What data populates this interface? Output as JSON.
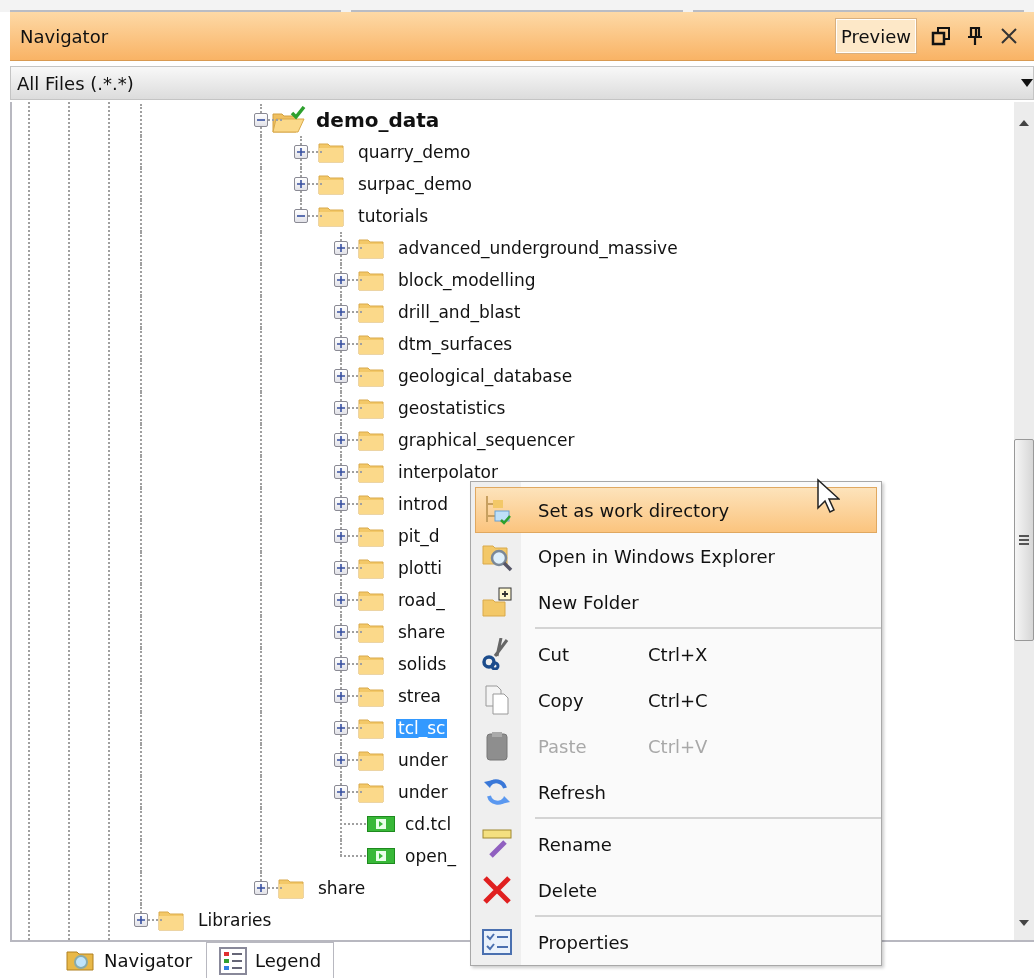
{
  "panel": {
    "title": "Navigator",
    "preview_button": "Preview"
  },
  "filter": {
    "value": "All Files (.*.*)"
  },
  "tree": [
    {
      "children": [
        {
          "children": [
            {
              "children": [
                {
                  "label": "demo_data",
                  "kind": "folder",
                  "expanded": true,
                  "selected": false,
                  "work_directory": true,
                  "children": [
                    {
                      "label": "quarry_demo",
                      "kind": "folder",
                      "expanded": false,
                      "selected": false,
                      "work_directory": false
                    },
                    {
                      "label": "surpac_demo",
                      "kind": "folder",
                      "expanded": false,
                      "selected": false,
                      "work_directory": false
                    },
                    {
                      "label": "tutorials",
                      "kind": "folder",
                      "expanded": true,
                      "selected": false,
                      "work_directory": false,
                      "children": [
                        {
                          "label": "advanced_underground_massive",
                          "kind": "folder",
                          "expanded": false,
                          "selected": false,
                          "work_directory": false
                        },
                        {
                          "label": "block_modelling",
                          "kind": "folder",
                          "expanded": false,
                          "selected": false,
                          "work_directory": false
                        },
                        {
                          "label": "drill_and_blast",
                          "kind": "folder",
                          "expanded": false,
                          "selected": false,
                          "work_directory": false
                        },
                        {
                          "label": "dtm_surfaces",
                          "kind": "folder",
                          "expanded": false,
                          "selected": false,
                          "work_directory": false
                        },
                        {
                          "label": "geological_database",
                          "kind": "folder",
                          "expanded": false,
                          "selected": false,
                          "work_directory": false
                        },
                        {
                          "label": "geostatistics",
                          "kind": "folder",
                          "expanded": false,
                          "selected": false,
                          "work_directory": false
                        },
                        {
                          "label": "graphical_sequencer",
                          "kind": "folder",
                          "expanded": false,
                          "selected": false,
                          "work_directory": false
                        },
                        {
                          "label": "interpolator",
                          "kind": "folder",
                          "expanded": false,
                          "selected": false,
                          "work_directory": false
                        },
                        {
                          "label": "introd",
                          "kind": "folder",
                          "expanded": false,
                          "selected": false,
                          "work_directory": false
                        },
                        {
                          "label": "pit_d",
                          "kind": "folder",
                          "expanded": false,
                          "selected": false,
                          "work_directory": false
                        },
                        {
                          "label": "plotti",
                          "kind": "folder",
                          "expanded": false,
                          "selected": false,
                          "work_directory": false
                        },
                        {
                          "label": "road_",
                          "kind": "folder",
                          "expanded": false,
                          "selected": false,
                          "work_directory": false
                        },
                        {
                          "label": "share",
                          "kind": "folder",
                          "expanded": false,
                          "selected": false,
                          "work_directory": false
                        },
                        {
                          "label": "solids",
                          "kind": "folder",
                          "expanded": false,
                          "selected": false,
                          "work_directory": false
                        },
                        {
                          "label": "strea",
                          "kind": "folder",
                          "expanded": false,
                          "selected": false,
                          "work_directory": false
                        },
                        {
                          "label": "tcl_sc",
                          "kind": "folder",
                          "expanded": false,
                          "selected": true,
                          "work_directory": false
                        },
                        {
                          "label": "under",
                          "kind": "folder",
                          "expanded": false,
                          "selected": false,
                          "work_directory": false
                        },
                        {
                          "label": "under",
                          "kind": "folder",
                          "expanded": false,
                          "selected": false,
                          "work_directory": false
                        },
                        {
                          "label": "cd.tcl",
                          "kind": "file",
                          "selected": false,
                          "work_directory": false
                        },
                        {
                          "label": "open_",
                          "kind": "file",
                          "selected": false,
                          "work_directory": false
                        }
                      ]
                    }
                  ]
                },
                {
                  "label": "share",
                  "kind": "folder",
                  "expanded": false,
                  "selected": false,
                  "work_directory": false
                }
              ]
            }
          ]
        }
      ]
    },
    {
      "label": "Libraries",
      "kind": "folder",
      "expanded": false,
      "selected": false,
      "work_directory": false
    }
  ],
  "context_menu": [
    {
      "kind": "item",
      "label": "Set as work directory",
      "selected": true,
      "disabled": false
    },
    {
      "kind": "item",
      "label": "Open in Windows Explorer",
      "selected": false,
      "disabled": false
    },
    {
      "kind": "item",
      "label": "New Folder",
      "selected": false,
      "disabled": false
    },
    {
      "kind": "separator"
    },
    {
      "kind": "item",
      "label": "Cut",
      "shortcut": "Ctrl+X",
      "selected": false,
      "disabled": false
    },
    {
      "kind": "item",
      "label": "Copy",
      "shortcut": "Ctrl+C",
      "selected": false,
      "disabled": false
    },
    {
      "kind": "item",
      "label": "Paste",
      "shortcut": "Ctrl+V",
      "selected": false,
      "disabled": true
    },
    {
      "kind": "item",
      "label": "Refresh",
      "selected": false,
      "disabled": false
    },
    {
      "kind": "separator"
    },
    {
      "kind": "item",
      "label": "Rename",
      "selected": false,
      "disabled": false
    },
    {
      "kind": "item",
      "label": "Delete",
      "selected": false,
      "disabled": false
    },
    {
      "kind": "separator"
    },
    {
      "kind": "item",
      "label": "Properties",
      "selected": false,
      "disabled": false
    }
  ],
  "bottom_tabs": [
    {
      "label": "Navigator",
      "selected": true
    },
    {
      "label": "Legend",
      "selected": false
    }
  ]
}
